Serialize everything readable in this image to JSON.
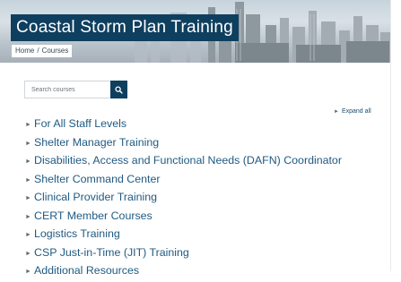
{
  "site": {
    "title": "Coastal Storm Plan Training"
  },
  "breadcrumb": {
    "home": "Home",
    "separator": "/",
    "current": "Courses"
  },
  "search": {
    "placeholder": "Search courses",
    "icon": "search-icon"
  },
  "expand_all": {
    "label": "Expand all",
    "icon": "triangle-right-icon"
  },
  "categories": [
    {
      "label": "For All Staff Levels"
    },
    {
      "label": "Shelter Manager Training"
    },
    {
      "label": "Disabilities, Access and Functional Needs (DAFN) Coordinator"
    },
    {
      "label": "Shelter Command Center"
    },
    {
      "label": "Clinical Provider Training"
    },
    {
      "label": "CERT Member Courses"
    },
    {
      "label": "Logistics Training"
    },
    {
      "label": "CSP Just-in-Time (JIT) Training"
    },
    {
      "label": "Additional Resources"
    }
  ],
  "colors": {
    "brand": "#0f3f5f",
    "link": "#1f5a82"
  }
}
